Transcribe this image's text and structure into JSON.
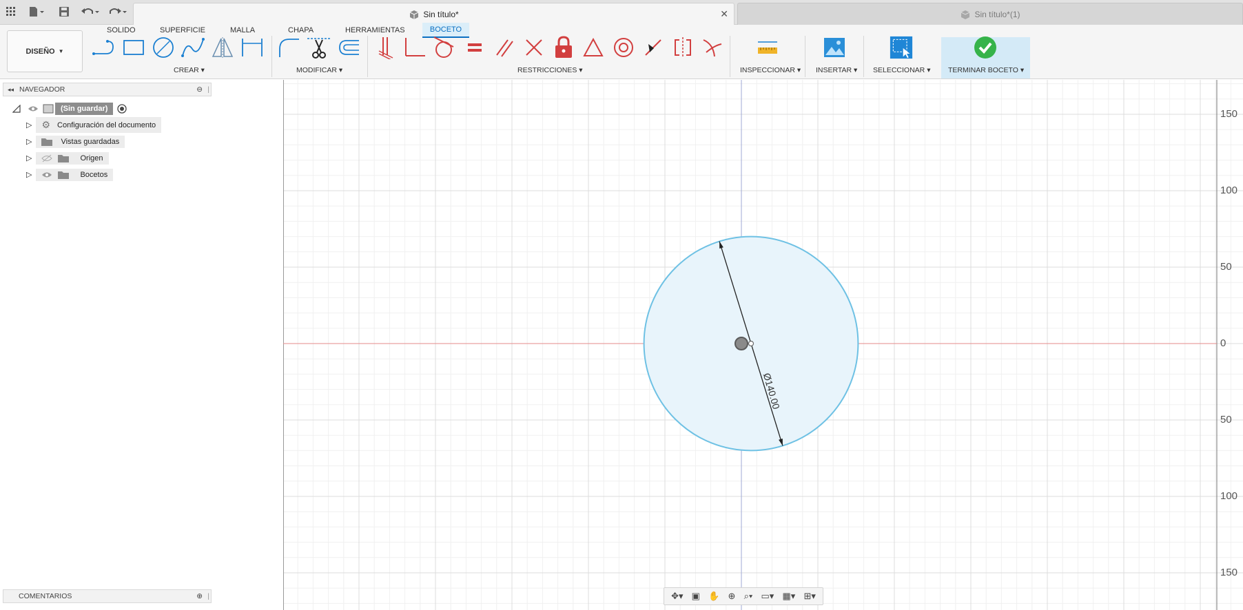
{
  "titlebar": {
    "active_tab_title": "Sin título*",
    "inactive_tab_title": "Sin título*(1)",
    "close_glyph": "✕"
  },
  "toolbar": {
    "design_label": "DISEÑO",
    "workspace_tabs": [
      {
        "label": "SOLIDO"
      },
      {
        "label": "SUPERFICIE"
      },
      {
        "label": "MALLA"
      },
      {
        "label": "CHAPA"
      },
      {
        "label": "HERRAMIENTAS"
      },
      {
        "label": "BOCETO"
      }
    ],
    "active_tab": "BOCETO",
    "groups": {
      "create": "CREAR",
      "modify": "MODIFICAR",
      "constraints": "RESTRICCIONES",
      "inspect": "INSPECCIONAR",
      "insert": "INSERTAR",
      "select": "SELECCIONAR",
      "finish": "TERMINAR BOCETO"
    },
    "accent_color": "#0a6fc2",
    "constraint_color": "#d23f3f"
  },
  "browser": {
    "header": "NAVEGADOR",
    "root": "(Sin guardar)",
    "items": [
      {
        "label": "Configuración del documento",
        "icon": "gear-icon"
      },
      {
        "label": "Vistas guardadas",
        "icon": "folder-icon"
      },
      {
        "label": "Origen",
        "icon": "folder-icon"
      },
      {
        "label": "Bocetos",
        "icon": "folder-icon"
      }
    ],
    "comments_header": "COMENTARIOS"
  },
  "canvas": {
    "ruler_labels": [
      "150",
      "100",
      "50",
      "0",
      "50",
      "100",
      "150"
    ],
    "dimension_label": "Ø140.00",
    "circle_diameter": 140,
    "circle_color": "#6ec1e4",
    "x_axis_color": "#e58a8a",
    "y_axis_color": "#9fa8d6"
  }
}
